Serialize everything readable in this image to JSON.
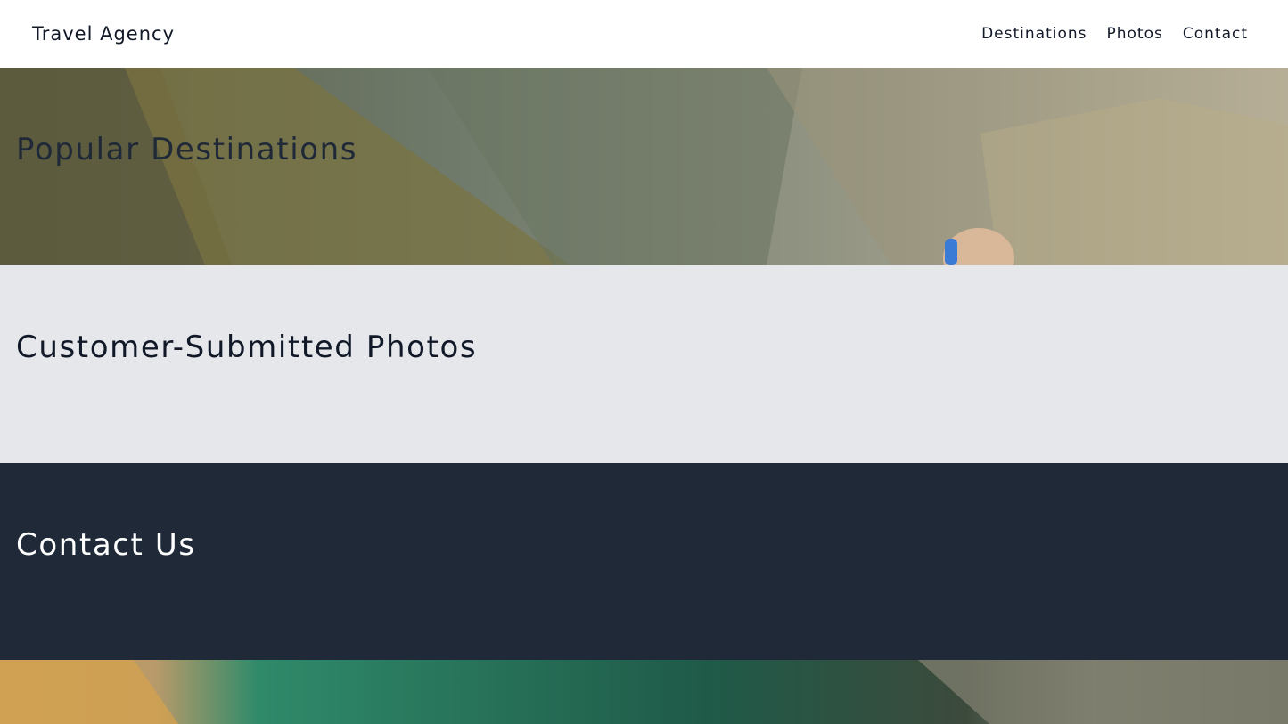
{
  "header": {
    "brand": "Travel Agency",
    "nav": [
      "Destinations",
      "Photos",
      "Contact"
    ]
  },
  "sections": {
    "destinations": {
      "title": "Popular Destinations"
    },
    "photos": {
      "title": "Customer-Submitted Photos"
    },
    "contact": {
      "title": "Contact Us"
    }
  },
  "colors": {
    "photos_bg": "#e5e7eb",
    "contact_bg": "#1f2937",
    "header_bg": "#ffffff"
  }
}
